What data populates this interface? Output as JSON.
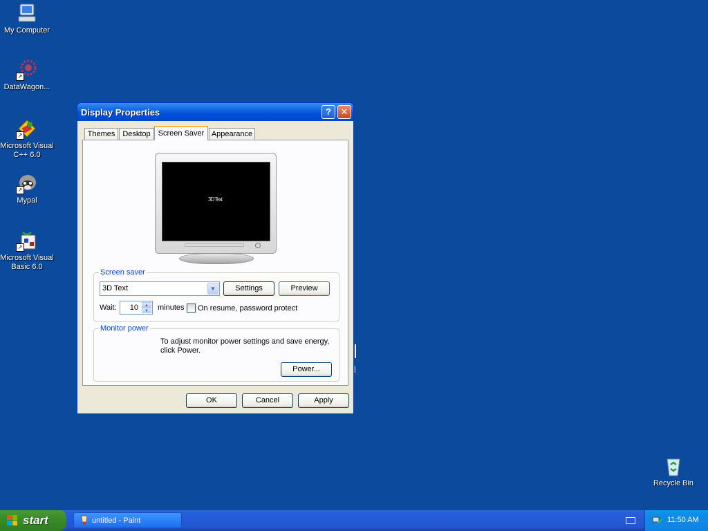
{
  "desktop": {
    "icons": [
      {
        "label": "My Computer"
      },
      {
        "label": "DataWagon..."
      },
      {
        "label": "Microsoft Visual\nC++ 6.0"
      },
      {
        "label": "Mypal"
      },
      {
        "label": "Microsoft Visual\nBasic 6.0"
      },
      {
        "label": "Recycle Bin"
      }
    ],
    "stray_text": "|"
  },
  "dialog": {
    "title": "Display Properties",
    "help_button": "?",
    "close_button": "✕",
    "tabs": [
      {
        "label": "Themes"
      },
      {
        "label": "Desktop"
      },
      {
        "label": "Screen Saver",
        "active": true
      },
      {
        "label": "Appearance"
      }
    ],
    "preview_text": "3D Text",
    "screen_saver": {
      "group_label": "Screen saver",
      "selected": "3D Text",
      "settings_button": "Settings",
      "preview_button": "Preview",
      "wait_label": "Wait:",
      "wait_value": "10",
      "minutes_label": "minutes",
      "password_label": "On resume, password protect",
      "password_checked": false
    },
    "monitor_power": {
      "group_label": "Monitor power",
      "description": "To adjust monitor power settings and save energy, click Power.",
      "power_button": "Power..."
    },
    "ok_button": "OK",
    "cancel_button": "Cancel",
    "apply_button": "Apply"
  },
  "taskbar": {
    "start_label": "start",
    "task": "untitled - Paint",
    "clock": "11:50 AM"
  },
  "colors": {
    "desktop": "#0b4a9c",
    "titlebar": "#0a5fe0",
    "group_label": "#0046d5",
    "start": "#3c8f2c"
  }
}
